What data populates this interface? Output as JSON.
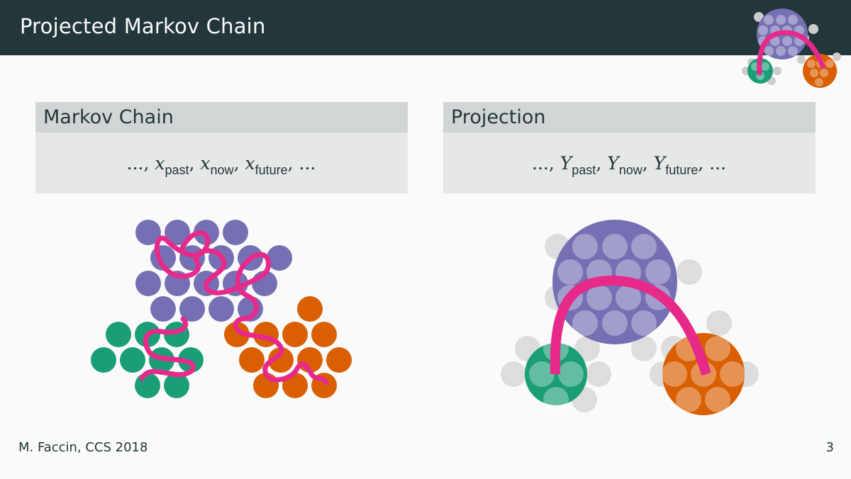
{
  "header": {
    "title": "Projected Markov Chain"
  },
  "blocks": {
    "markov": {
      "title": "Markov Chain",
      "sequence": {
        "lead": "..., ",
        "var": "x",
        "terms": [
          "past",
          "now",
          "future"
        ],
        "trail": ", ..."
      }
    },
    "projection": {
      "title": "Projection",
      "sequence": {
        "lead": "..., ",
        "var": "Y",
        "terms": [
          "past",
          "now",
          "future"
        ],
        "trail": ", ..."
      }
    }
  },
  "colors": {
    "header_bg": "#23373b",
    "purple": "#7570b3",
    "green": "#1b9e77",
    "orange": "#d95f02",
    "path": "#e7298a",
    "grey": "#cccccc"
  },
  "footer": {
    "author": "M. Faccin, CCS 2018",
    "page": "3"
  }
}
